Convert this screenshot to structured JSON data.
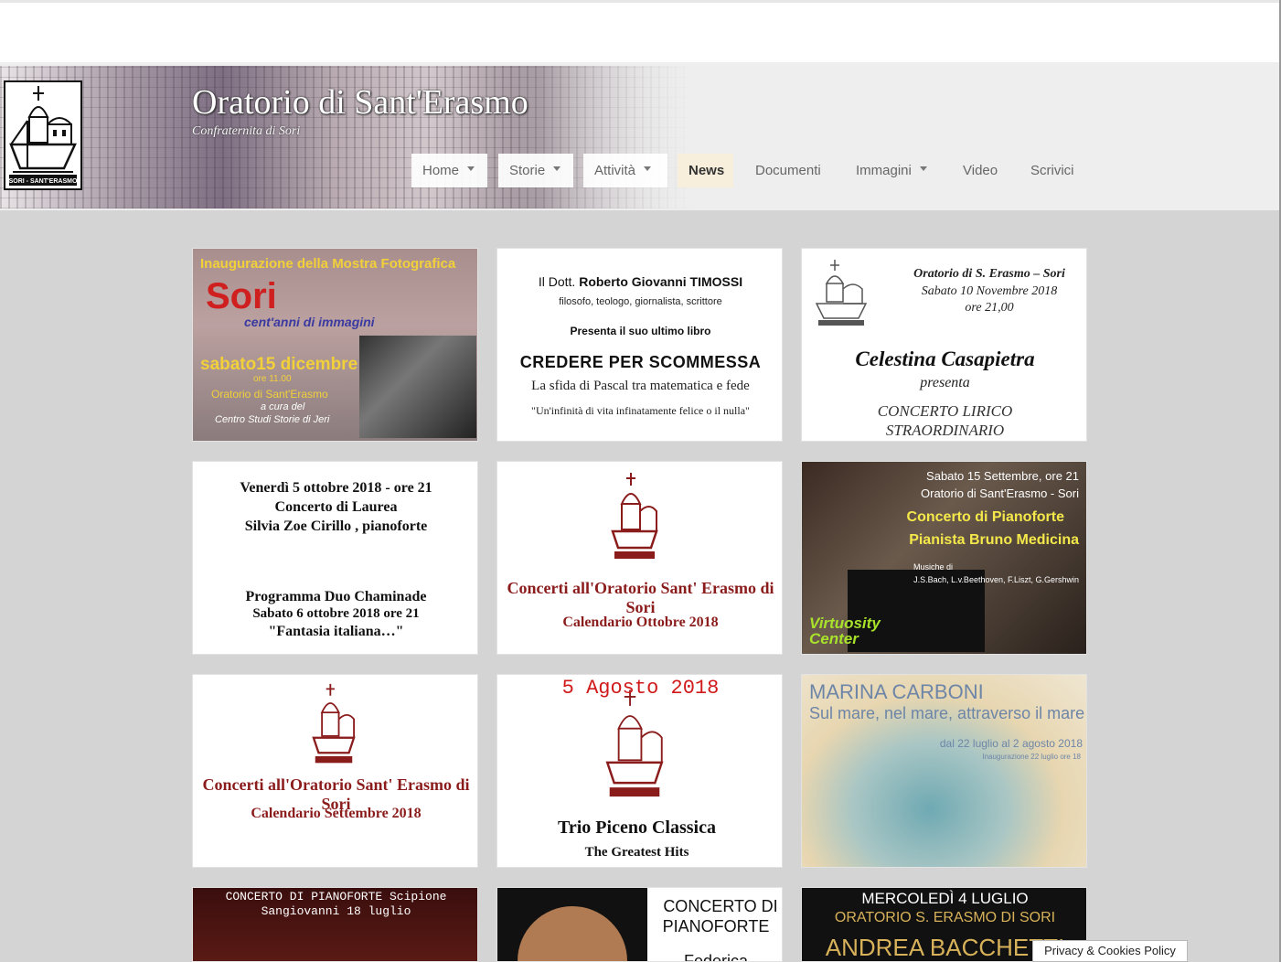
{
  "site": {
    "title": "Oratorio di Sant'Erasmo",
    "tagline": "Confraternita di Sori"
  },
  "nav": [
    {
      "label": "Home",
      "dropdown": true
    },
    {
      "label": "Storie",
      "dropdown": true
    },
    {
      "label": "Attività",
      "dropdown": true
    },
    {
      "label": "News",
      "dropdown": false,
      "active": true
    },
    {
      "label": "Documenti",
      "dropdown": false
    },
    {
      "label": "Immagini",
      "dropdown": true
    },
    {
      "label": "Video",
      "dropdown": false
    },
    {
      "label": "Scrivici",
      "dropdown": false
    }
  ],
  "logo": {
    "caption": "SORI - SANT'ERASMO",
    "icon": "oratorio-logo-icon"
  },
  "cards": {
    "mostra": {
      "heading": "Inaugurazione della Mostra Fotografica",
      "title": "Sori",
      "subtitle": "cent'anni di immagini",
      "date": "sabato15 dicembre",
      "time": "ore 11.00",
      "place": "Oratorio di Sant'Erasmo",
      "cura1": "a cura del",
      "cura2": "Centro Studi Storie di Jeri"
    },
    "timossi": {
      "line1_pre": "Il Dott.",
      "line1_name": "Roberto Giovanni TIMOSSI",
      "line2": "filosofo, teologo, giornalista, scrittore",
      "line3": "Presenta il suo ultimo libro",
      "title": "CREDERE PER SCOMMESSA",
      "subtitle": "La sfida di Pascal tra matematica e fede",
      "quote": "\"Un'infinità di vita infinatamente felice o il nulla\""
    },
    "celestina": {
      "venue": "Oratorio di S. Erasmo – Sori",
      "date": "Sabato 10 Novembre 2018",
      "time": "ore 21,00",
      "name": "Celestina Casapietra",
      "presenta": "presenta",
      "concert1": "CONCERTO LIRICO",
      "concert2": "STRAORDINARIO"
    },
    "laurea": {
      "l1": "Venerdì 5 ottobre 2018 - ore 21",
      "l2": "Concerto di Laurea",
      "l3": "Silvia Zoe Cirillo , pianoforte",
      "l4": "Programma Duo Chaminade",
      "l5": "Sabato 6 ottobre 2018 ore 21",
      "l6": "\"Fantasia italiana…\""
    },
    "ottobre": {
      "title": "Concerti all'Oratorio Sant' Erasmo di  Sori",
      "subtitle": "Calendario  Ottobre 2018"
    },
    "medicina": {
      "date": "Sabato 15 Settembre, ore 21",
      "venue": "Oratorio di Sant'Erasmo - Sori",
      "title": "Concerto di Pianoforte",
      "pianist": "Pianista Bruno Medicina",
      "musiche": "Musiche di",
      "composers": "J.S.Bach, L.v.Beethoven, F.Liszt, G.Gershwin",
      "brand": "Virtuosity Center"
    },
    "settembre": {
      "title": "Concerti all'Oratorio Sant' Erasmo di  Sori",
      "subtitle": "Calendario  Settembre 2018"
    },
    "piceno": {
      "date": "5 Agosto 2018",
      "title": "Trio Piceno Classica",
      "subtitle": "The Greatest Hits"
    },
    "carboni": {
      "name": "MARINA CARBONI",
      "title": "Sul mare, nel mare, attraverso il mare",
      "dates": "dal 22 luglio al 2 agosto 2018",
      "inaug": "Inaugurazione 22 luglio ore 18"
    },
    "sangiovanni": {
      "l1": "CONCERTO DI PIANOFORTE  Scipione",
      "l2": "Sangiovanni  18 luglio"
    },
    "concerto_pf": {
      "l1": "CONCERTO DI",
      "l2": "PIANOFORTE",
      "l3": "Federica"
    },
    "bacchetti": {
      "l1": "MERCOLEDÌ 4 LUGLIO",
      "l2": "ORATORIO S. ERASMO DI SORI",
      "l3": "ANDREA BACCHETTI"
    }
  },
  "privacy": "Privacy & Cookies Policy",
  "colors": {
    "maroon": "#8b1c1c",
    "active_nav": "#f7efdc",
    "page_bg": "#d4d4d4"
  }
}
